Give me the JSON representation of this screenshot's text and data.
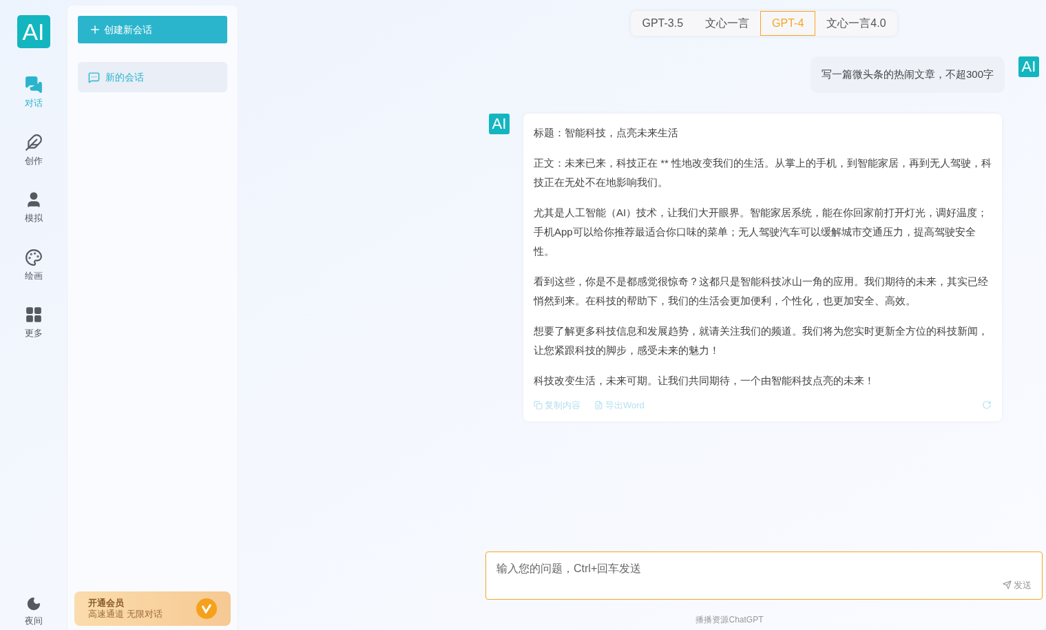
{
  "logo": {
    "text": "AI"
  },
  "nav": [
    {
      "label": "对话",
      "kind": "chat",
      "selected": true
    },
    {
      "label": "创作",
      "kind": "feather",
      "selected": false
    },
    {
      "label": "模拟",
      "kind": "head",
      "selected": false
    },
    {
      "label": "绘画",
      "kind": "palette",
      "selected": false
    },
    {
      "label": "更多",
      "kind": "grid",
      "selected": false
    }
  ],
  "night": {
    "label": "夜间"
  },
  "sidebar": {
    "new_button": "创建新会话",
    "conversations": [
      {
        "title": "新的会话",
        "selected": true
      }
    ],
    "vip": {
      "title": "开通会员",
      "subtitle": "高速通道 无限对话"
    }
  },
  "model_tabs": [
    {
      "label": "GPT-3.5",
      "selected": false
    },
    {
      "label": "文心一言",
      "selected": false
    },
    {
      "label": "GPT-4",
      "selected": true
    },
    {
      "label": "文心一言4.0",
      "selected": false
    }
  ],
  "messages": [
    {
      "kind": "user",
      "avatar": "AI",
      "paragraphs": [
        "写一篇微头条的热闹文章，不超300字"
      ]
    },
    {
      "kind": "answer",
      "avatar": "AI",
      "paragraphs": [
        "标题：智能科技，点亮未来生活",
        "正文：未来已来，科技正在 ** 性地改变我们的生活。从掌上的手机，到智能家居，再到无人驾驶，科技正在无处不在地影响我们。",
        "尤其是人工智能（AI）技术，让我们大开眼界。智能家居系统，能在你回家前打开灯光，调好温度；手机App可以给你推荐最适合你口味的菜单；无人驾驶汽车可以缓解城市交通压力，提高驾驶安全性。",
        "看到这些，你是不是都感觉很惊奇？这都只是智能科技冰山一角的应用。我们期待的未来，其实已经悄然到来。在科技的帮助下，我们的生活会更加便利，个性化，也更加安全、高效。",
        "想要了解更多科技信息和发展趋势，就请关注我们的频道。我们将为您实时更新全方位的科技新闻，让您紧跟科技的脚步，感受未来的魅力！",
        "科技改变生活，未来可期。让我们共同期待，一个由智能科技点亮的未来！"
      ],
      "actions": [
        "复制内容",
        "导出Word"
      ]
    }
  ],
  "input": {
    "placeholder": "输入您的问题，Ctrl+回车发送",
    "send": "发送"
  },
  "footer": "播播资源ChatGPT"
}
